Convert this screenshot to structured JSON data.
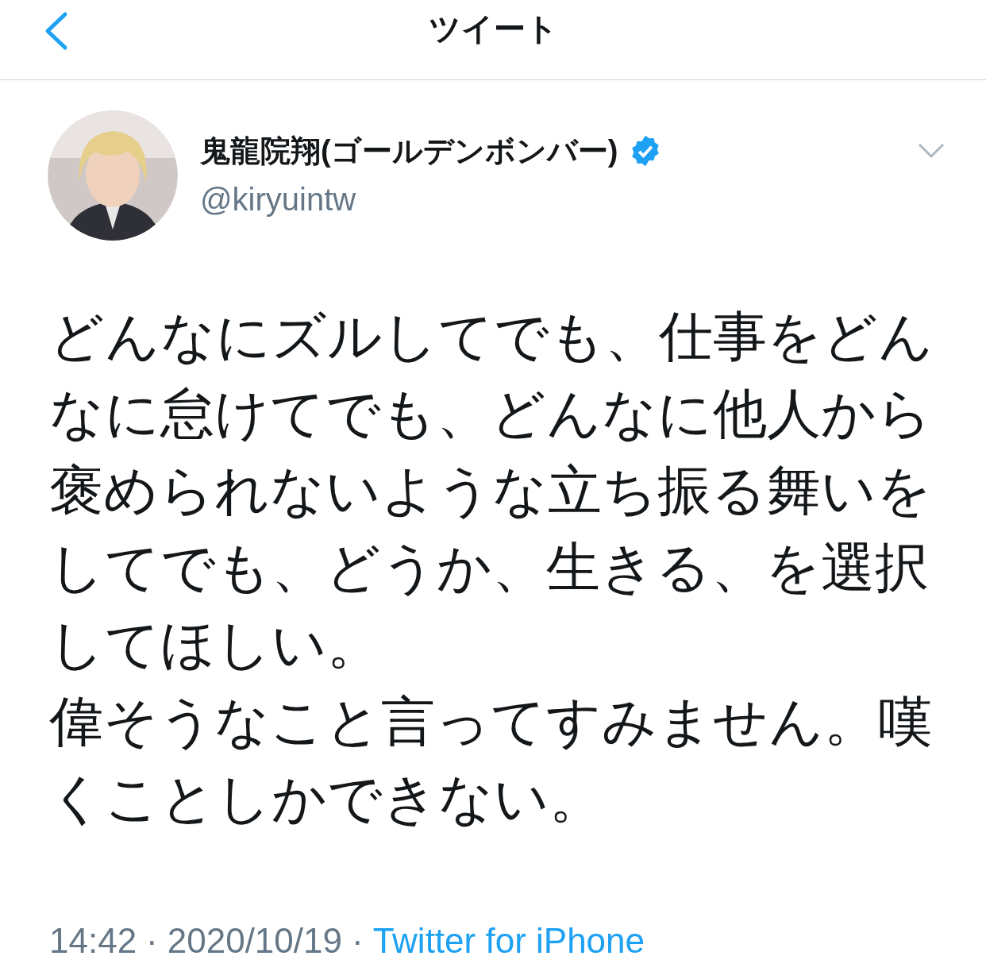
{
  "header": {
    "title": "ツイート"
  },
  "author": {
    "name": "鬼龍院翔(ゴールデンボンバー)",
    "verified": true,
    "handle": "@kiryuintw"
  },
  "tweet": {
    "paragraphs": [
      "どんなにズルしてでも、仕事をどんなに怠けてでも、どんなに他人から褒められないような立ち振る舞いをしてでも、どうか、生きる、を選択してほしい。",
      "偉そうなこと言ってすみません。嘆くことしかできない。"
    ]
  },
  "meta": {
    "time": "14:42",
    "separator_1": "·",
    "date": "2020/10/19",
    "separator_2": "·",
    "source": "Twitter for iPhone"
  }
}
